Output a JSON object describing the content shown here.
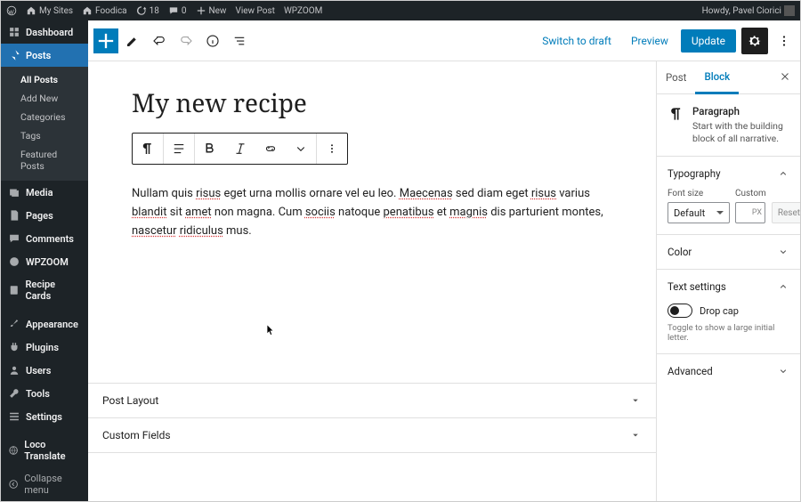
{
  "adminbar": {
    "my_sites": "My Sites",
    "site_name": "Foodica",
    "updates_count": "18",
    "comments_count": "0",
    "new_label": "New",
    "view_post": "View Post",
    "wpzoom": "WPZOOM",
    "greeting": "Howdy, Pavel Ciorici"
  },
  "menu": {
    "dashboard": "Dashboard",
    "posts": "Posts",
    "posts_sub": [
      "All Posts",
      "Add New",
      "Categories",
      "Tags",
      "Featured Posts"
    ],
    "media": "Media",
    "pages": "Pages",
    "comments": "Comments",
    "wpzoom": "WPZOOM",
    "recipe_cards": "Recipe Cards",
    "appearance": "Appearance",
    "plugins": "Plugins",
    "users": "Users",
    "tools": "Tools",
    "settings": "Settings",
    "loco": "Loco Translate",
    "collapse": "Collapse menu"
  },
  "header": {
    "switch_to_draft": "Switch to draft",
    "preview": "Preview",
    "update": "Update"
  },
  "post": {
    "title": "My new recipe",
    "paragraph_html": "Nullam quis <span class='ul'>risus</span> eget urna mollis ornare vel eu leo. <span class='ul'>Maecenas</span> sed diam eget <span class='ul'>risus</span> varius <span class='ul'>blandit</span> sit <span class='ul'>amet</span> non magna. Cum <span class='ul'>sociis</span> natoque <span class='ul'>penatibus</span> et <span class='ul'>magnis</span> dis parturient montes, <span class='ul'>nascetur</span> <span class='ul'>ridiculus</span> mus."
  },
  "metaboxes": {
    "post_layout": "Post Layout",
    "custom_fields": "Custom Fields"
  },
  "inspector": {
    "tab_post": "Post",
    "tab_block": "Block",
    "block_name": "Paragraph",
    "block_desc": "Start with the building block of all narrative.",
    "typography": "Typography",
    "font_size_label": "Font size",
    "custom_label": "Custom",
    "font_size_value": "Default",
    "custom_unit": "PX",
    "reset": "Reset",
    "color": "Color",
    "text_settings": "Text settings",
    "drop_cap": "Drop cap",
    "drop_cap_help": "Toggle to show a large initial letter.",
    "advanced": "Advanced"
  }
}
